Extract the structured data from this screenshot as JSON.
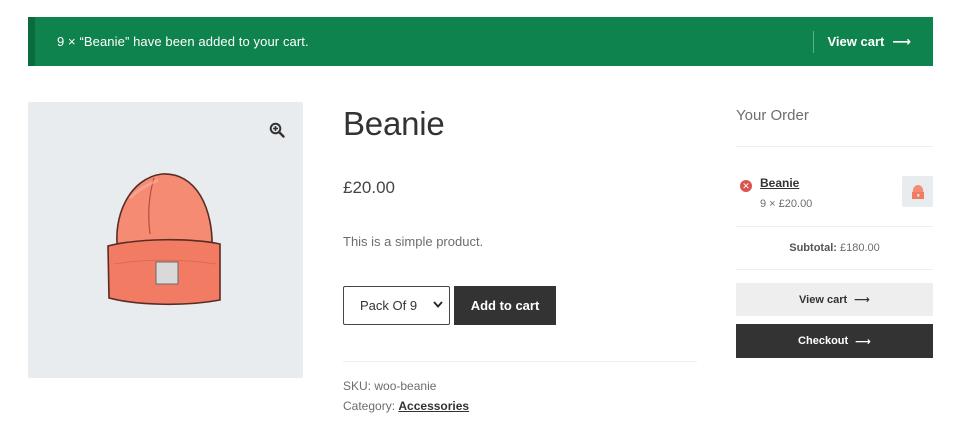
{
  "notice": {
    "message": "9 × “Beanie” have been added to your cart.",
    "action_label": "View cart",
    "arrow": "⟶",
    "bg_color": "#0f834d"
  },
  "gallery": {
    "zoom_icon": "zoom-in-icon",
    "image_icon": "beanie-image"
  },
  "product": {
    "title": "Beanie",
    "price": "£20.00",
    "description": "This is a simple product.",
    "variation_selected": "Pack Of 9",
    "add_to_cart_label": "Add to cart",
    "sku_label": "SKU:",
    "sku_value": "woo-beanie",
    "category_label": "Category:",
    "category_value": "Accessories"
  },
  "mini_cart": {
    "title": "Your Order",
    "item_name": "Beanie",
    "item_qty": "9 × £20.00",
    "remove_icon": "remove-icon",
    "subtotal_label": "Subtotal:",
    "subtotal_value": "£180.00",
    "view_cart_label": "View cart",
    "checkout_label": "Checkout",
    "arrow": "⟶"
  },
  "colors": {
    "accent_green": "#0f834d",
    "dark_button": "#333333",
    "remove_red": "#d9534f",
    "beanie_orange": "#f08a73"
  }
}
